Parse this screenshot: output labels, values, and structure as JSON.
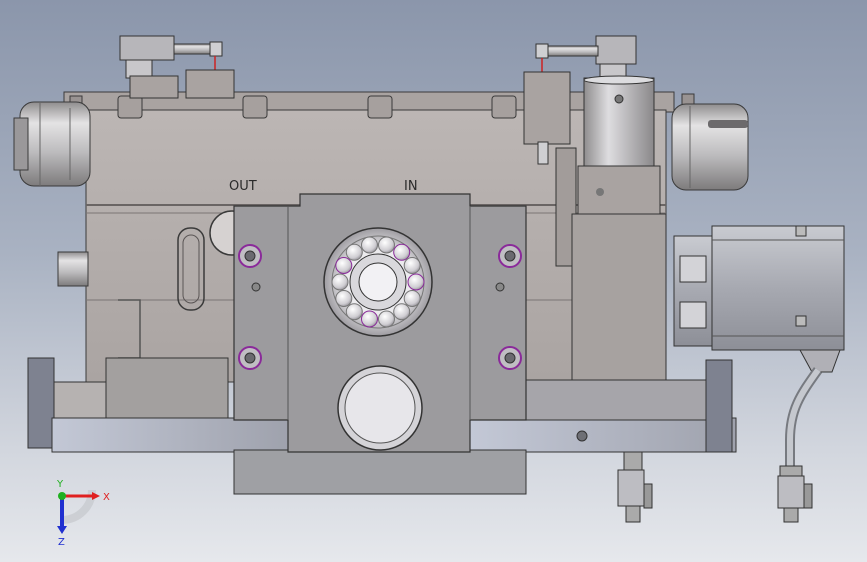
{
  "labels": {
    "out": "OUT",
    "in": "IN"
  },
  "triad": {
    "x": "X",
    "y": "Y",
    "z": "Z",
    "x_color": "#e02020",
    "y_color": "#20b020",
    "z_color": "#2030d0"
  },
  "colors": {
    "housing": "#b3adab",
    "housing_dark": "#948e8c",
    "plate": "#9d9c9f",
    "base": "#a2a5ae",
    "motor": "#a9abb3",
    "bolt_accent": "#8a2a9a",
    "wire": "#cc2222"
  }
}
